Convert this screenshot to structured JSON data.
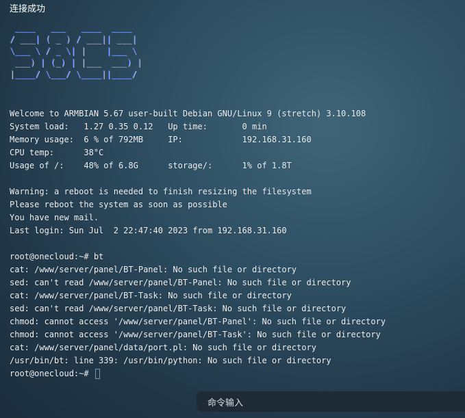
{
  "status": "连接成功",
  "ascii_logo": " ____   ___   ____  ____\n/ ___| ( _ ) / ___|| ___|\n\\___ \\ / _ \\| |    |___ \\\n ___) | (_) | |___  ___) |\n|____/ \\___/ \\____||____/",
  "lines": [
    "Welcome to ARMBIAN 5.67 user-built Debian GNU/Linux 9 (stretch) 3.10.108",
    "System load:   1.27 0.35 0.12   Up time:       0 min",
    "Memory usage:  6 % of 792MB     IP:            192.168.31.160",
    "CPU temp:      38°C",
    "Usage of /:    48% of 6.8G      storage/:      1% of 1.8T",
    "",
    "Warning: a reboot is needed to finish resizing the filesystem",
    "Please reboot the system as soon as possible",
    "You have new mail.",
    "Last login: Sun Jul  2 22:47:40 2023 from 192.168.31.160",
    "",
    "root@onecloud:~# bt",
    "cat: /www/server/panel/BT-Panel: No such file or directory",
    "sed: can't read /www/server/panel/BT-Panel: No such file or directory",
    "cat: /www/server/panel/BT-Task: No such file or directory",
    "sed: can't read /www/server/panel/BT-Task: No such file or directory",
    "chmod: cannot access '/www/server/panel/BT-Panel': No such file or directory",
    "chmod: cannot access '/www/server/panel/BT-Task': No such file or directory",
    "cat: /www/server/panel/data/port.pl: No such file or directory",
    "/usr/bin/bt: line 339: /usr/bin/python: No such file or directory"
  ],
  "prompt": "root@onecloud:~# ",
  "command_bar": {
    "label": "命令输入"
  },
  "colors": {
    "cursor": "#1ecf72",
    "logo": "#3e5fe0"
  }
}
